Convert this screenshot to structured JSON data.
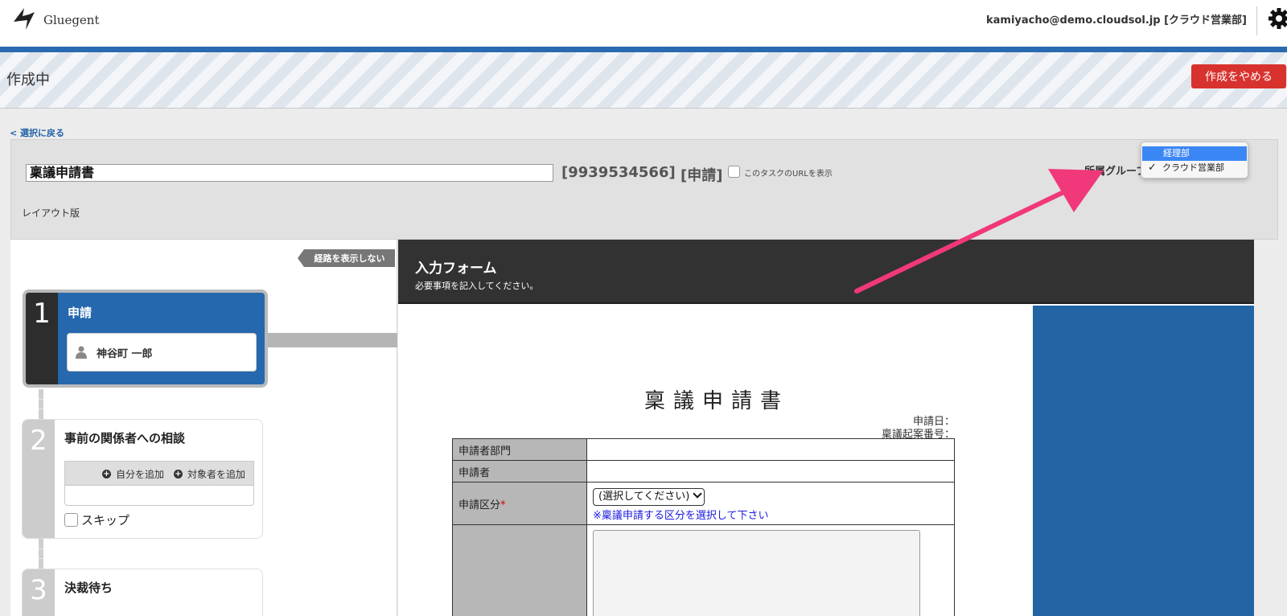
{
  "header": {
    "logo_text": "Gluegent",
    "user_info": "kamiyacho@demo.cloudsol.jp [クラウド営業部]"
  },
  "banner": {
    "status": "作成中",
    "cancel_label": "作成をやめる"
  },
  "nav": {
    "back_link": "< 選択に戻る"
  },
  "task": {
    "title_value": "稟議申請書",
    "task_id": "[9939534566]",
    "task_kind": "[申請]",
    "show_url_label": "このタスクのURLを表示",
    "layout_label": "レイアウト版",
    "group_label": "所属グループ"
  },
  "group_dropdown": {
    "options": [
      "経理部",
      "クラウド営業部"
    ],
    "highlighted": "経理部",
    "selected": "クラウド営業部",
    "check_mark": "✓"
  },
  "route": {
    "hide_route_label": "経路を表示しない",
    "steps": [
      {
        "number": "1",
        "title": "申請",
        "assignee": "神谷町 一郎"
      },
      {
        "number": "2",
        "title": "事前の関係者への相談",
        "add_self": "自分を追加",
        "add_target": "対象者を追加",
        "skip_label": "スキップ"
      },
      {
        "number": "3",
        "title": "決裁待ち"
      }
    ]
  },
  "form": {
    "header_title": "入力フォーム",
    "header_subtitle": "必要事項を記入してください。",
    "doc_title": "稟議申請書",
    "apply_date_label": "申請日：",
    "ringi_no_label": "稟議起案番号：",
    "rows": {
      "dept_label": "申請者部門",
      "applicant_label": "申請者",
      "category_label": "申請区分",
      "required_mark": "*",
      "category_select": "(選択してください)",
      "category_hint": "※稟議申請する区分を選択して下さい"
    }
  },
  "colors": {
    "brand_blue": "#2a6ab0",
    "cancel_red": "#d8322e",
    "annotation_pink": "#f0387a"
  }
}
